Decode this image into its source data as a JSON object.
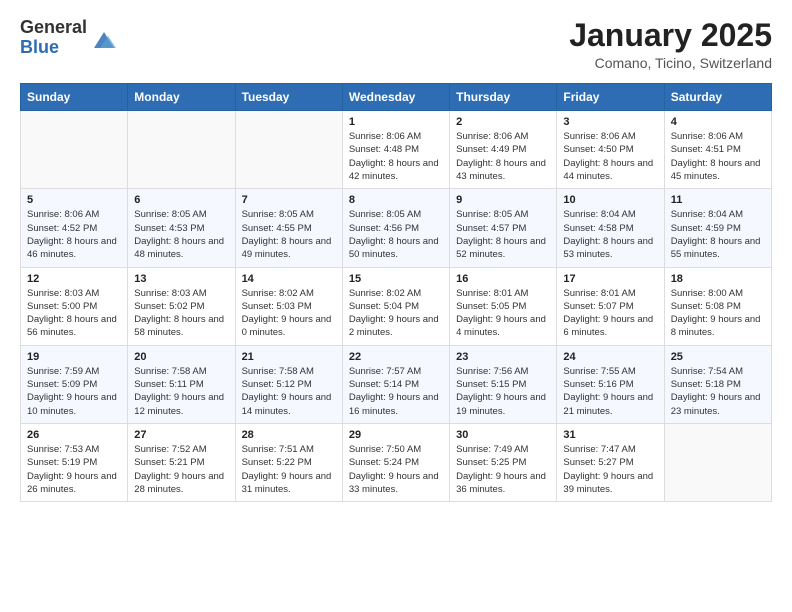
{
  "header": {
    "logo_general": "General",
    "logo_blue": "Blue",
    "month_title": "January 2025",
    "location": "Comano, Ticino, Switzerland"
  },
  "weekdays": [
    "Sunday",
    "Monday",
    "Tuesday",
    "Wednesday",
    "Thursday",
    "Friday",
    "Saturday"
  ],
  "weeks": [
    [
      {
        "day": "",
        "info": ""
      },
      {
        "day": "",
        "info": ""
      },
      {
        "day": "",
        "info": ""
      },
      {
        "day": "1",
        "info": "Sunrise: 8:06 AM\nSunset: 4:48 PM\nDaylight: 8 hours and 42 minutes."
      },
      {
        "day": "2",
        "info": "Sunrise: 8:06 AM\nSunset: 4:49 PM\nDaylight: 8 hours and 43 minutes."
      },
      {
        "day": "3",
        "info": "Sunrise: 8:06 AM\nSunset: 4:50 PM\nDaylight: 8 hours and 44 minutes."
      },
      {
        "day": "4",
        "info": "Sunrise: 8:06 AM\nSunset: 4:51 PM\nDaylight: 8 hours and 45 minutes."
      }
    ],
    [
      {
        "day": "5",
        "info": "Sunrise: 8:06 AM\nSunset: 4:52 PM\nDaylight: 8 hours and 46 minutes."
      },
      {
        "day": "6",
        "info": "Sunrise: 8:05 AM\nSunset: 4:53 PM\nDaylight: 8 hours and 48 minutes."
      },
      {
        "day": "7",
        "info": "Sunrise: 8:05 AM\nSunset: 4:55 PM\nDaylight: 8 hours and 49 minutes."
      },
      {
        "day": "8",
        "info": "Sunrise: 8:05 AM\nSunset: 4:56 PM\nDaylight: 8 hours and 50 minutes."
      },
      {
        "day": "9",
        "info": "Sunrise: 8:05 AM\nSunset: 4:57 PM\nDaylight: 8 hours and 52 minutes."
      },
      {
        "day": "10",
        "info": "Sunrise: 8:04 AM\nSunset: 4:58 PM\nDaylight: 8 hours and 53 minutes."
      },
      {
        "day": "11",
        "info": "Sunrise: 8:04 AM\nSunset: 4:59 PM\nDaylight: 8 hours and 55 minutes."
      }
    ],
    [
      {
        "day": "12",
        "info": "Sunrise: 8:03 AM\nSunset: 5:00 PM\nDaylight: 8 hours and 56 minutes."
      },
      {
        "day": "13",
        "info": "Sunrise: 8:03 AM\nSunset: 5:02 PM\nDaylight: 8 hours and 58 minutes."
      },
      {
        "day": "14",
        "info": "Sunrise: 8:02 AM\nSunset: 5:03 PM\nDaylight: 9 hours and 0 minutes."
      },
      {
        "day": "15",
        "info": "Sunrise: 8:02 AM\nSunset: 5:04 PM\nDaylight: 9 hours and 2 minutes."
      },
      {
        "day": "16",
        "info": "Sunrise: 8:01 AM\nSunset: 5:05 PM\nDaylight: 9 hours and 4 minutes."
      },
      {
        "day": "17",
        "info": "Sunrise: 8:01 AM\nSunset: 5:07 PM\nDaylight: 9 hours and 6 minutes."
      },
      {
        "day": "18",
        "info": "Sunrise: 8:00 AM\nSunset: 5:08 PM\nDaylight: 9 hours and 8 minutes."
      }
    ],
    [
      {
        "day": "19",
        "info": "Sunrise: 7:59 AM\nSunset: 5:09 PM\nDaylight: 9 hours and 10 minutes."
      },
      {
        "day": "20",
        "info": "Sunrise: 7:58 AM\nSunset: 5:11 PM\nDaylight: 9 hours and 12 minutes."
      },
      {
        "day": "21",
        "info": "Sunrise: 7:58 AM\nSunset: 5:12 PM\nDaylight: 9 hours and 14 minutes."
      },
      {
        "day": "22",
        "info": "Sunrise: 7:57 AM\nSunset: 5:14 PM\nDaylight: 9 hours and 16 minutes."
      },
      {
        "day": "23",
        "info": "Sunrise: 7:56 AM\nSunset: 5:15 PM\nDaylight: 9 hours and 19 minutes."
      },
      {
        "day": "24",
        "info": "Sunrise: 7:55 AM\nSunset: 5:16 PM\nDaylight: 9 hours and 21 minutes."
      },
      {
        "day": "25",
        "info": "Sunrise: 7:54 AM\nSunset: 5:18 PM\nDaylight: 9 hours and 23 minutes."
      }
    ],
    [
      {
        "day": "26",
        "info": "Sunrise: 7:53 AM\nSunset: 5:19 PM\nDaylight: 9 hours and 26 minutes."
      },
      {
        "day": "27",
        "info": "Sunrise: 7:52 AM\nSunset: 5:21 PM\nDaylight: 9 hours and 28 minutes."
      },
      {
        "day": "28",
        "info": "Sunrise: 7:51 AM\nSunset: 5:22 PM\nDaylight: 9 hours and 31 minutes."
      },
      {
        "day": "29",
        "info": "Sunrise: 7:50 AM\nSunset: 5:24 PM\nDaylight: 9 hours and 33 minutes."
      },
      {
        "day": "30",
        "info": "Sunrise: 7:49 AM\nSunset: 5:25 PM\nDaylight: 9 hours and 36 minutes."
      },
      {
        "day": "31",
        "info": "Sunrise: 7:47 AM\nSunset: 5:27 PM\nDaylight: 9 hours and 39 minutes."
      },
      {
        "day": "",
        "info": ""
      }
    ]
  ]
}
